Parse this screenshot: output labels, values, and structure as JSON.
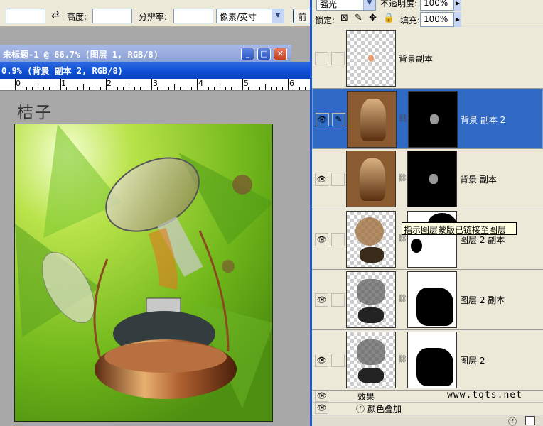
{
  "options_bar": {
    "width_value": "",
    "height_label": "高度:",
    "height_value": "",
    "resolution_label": "分辨率:",
    "resolution_value": "",
    "unit_select": "像素/英寸",
    "front_button": "前"
  },
  "back_window": {
    "title": "未标题-1 @ 66.7% (图层 1, RGB/8)"
  },
  "front_window": {
    "title": "0.9% (背景 副本 2, RGB/8)",
    "ruler_numbers": [
      "0",
      "1",
      "2",
      "3",
      "4",
      "5",
      "6"
    ],
    "canvas_text": "桔子"
  },
  "layers_panel": {
    "blend_mode": "强光",
    "opacity_label": "不透明度:",
    "opacity_value": "100%",
    "lock_label": "锁定:",
    "fill_label": "填充:",
    "fill_value": "100%",
    "layers": [
      {
        "name": "背景副本",
        "visible": false,
        "has_mask": false,
        "selected": false
      },
      {
        "name": "背景 副本 2",
        "visible": true,
        "has_mask": true,
        "selected": true
      },
      {
        "name": "背景 副本",
        "visible": true,
        "has_mask": true,
        "selected": false
      },
      {
        "name": "图层 2 副本",
        "visible": true,
        "has_mask": true,
        "selected": false
      },
      {
        "name": "图层 2  副本",
        "visible": true,
        "has_mask": true,
        "selected": false
      },
      {
        "name": "图层 2",
        "visible": true,
        "has_mask": true,
        "selected": false
      }
    ],
    "effects_label": "效果",
    "color_overlay_label": "颜色叠加",
    "watermark": "www.tqts.net",
    "tooltip": "指示图层蒙版已链接至图层"
  }
}
